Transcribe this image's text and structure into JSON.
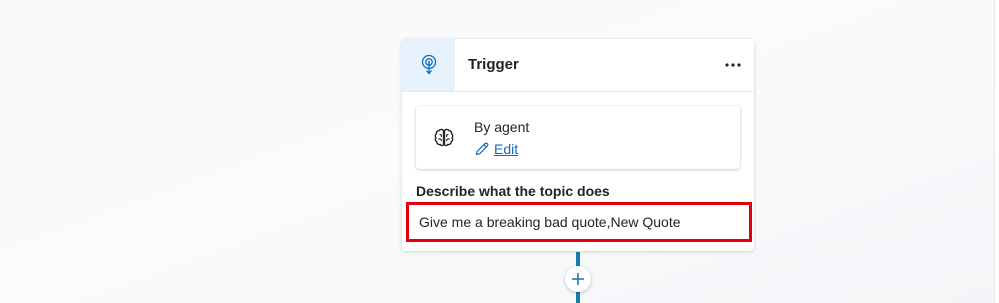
{
  "trigger_card": {
    "title": "Trigger",
    "trigger_icon": "broadcast-signal-icon",
    "more_icon": "more-horizontal-icon",
    "agent": {
      "label": "By agent",
      "icon": "brain-icon",
      "edit_icon": "pencil-icon",
      "edit_label": "Edit"
    },
    "description": {
      "label": "Describe what the topic does",
      "value": "Give me a breaking bad quote,New Quote"
    }
  },
  "canvas": {
    "add_node_icon": "plus-icon"
  },
  "colors": {
    "accent": "#0f6cbd",
    "connector": "#1a7cac",
    "highlight": "#e3000b",
    "icon_box": "#e6f1fb"
  }
}
